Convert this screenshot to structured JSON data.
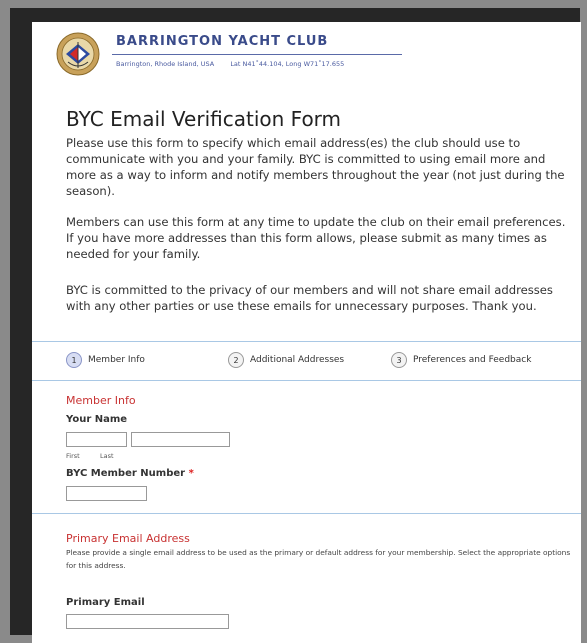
{
  "header": {
    "club_name": "BARRINGTON YACHT CLUB",
    "location": "Barrington, Rhode Island, USA",
    "coords": "Lat N41˚44.104, Long W71˚17.655"
  },
  "title": "BYC Email Verification Form",
  "paragraphs": [
    "Please use this form to specify which email address(es) the club should use to communicate with you and your family. BYC is committed to using email more and more as a way to inform and notify members throughout the year (not just during the season).",
    "Members can use this form at any time to update the club on their email preferences. If you have more addresses than this form allows, please submit as many times as needed for your family.",
    "BYC is committed to the privacy of our members and will not share email addresses with any other parties or use these emails for unnecessary purposes. Thank you."
  ],
  "steps": [
    {
      "num": "1",
      "label": "Member Info",
      "active": true
    },
    {
      "num": "2",
      "label": "Additional Addresses",
      "active": false
    },
    {
      "num": "3",
      "label": "Preferences and Feedback",
      "active": false
    }
  ],
  "member_info": {
    "section_title": "Member Info",
    "your_name_label": "Your Name",
    "first_label": "First",
    "last_label": "Last",
    "first_value": "",
    "last_value": "",
    "member_number_label": "BYC Member Number",
    "required_mark": "*",
    "member_number_value": ""
  },
  "primary_email": {
    "section_title": "Primary Email Address",
    "help_text": "Please provide a single email address to be used as the primary or default address for your membership. Select the appropriate options for this address.",
    "label": "Primary Email",
    "value": ""
  },
  "colors": {
    "section_title": "#c83232",
    "club_blue": "#3a4b8a",
    "divider": "#a9c8e5",
    "active_step": "#d7ddf3"
  }
}
